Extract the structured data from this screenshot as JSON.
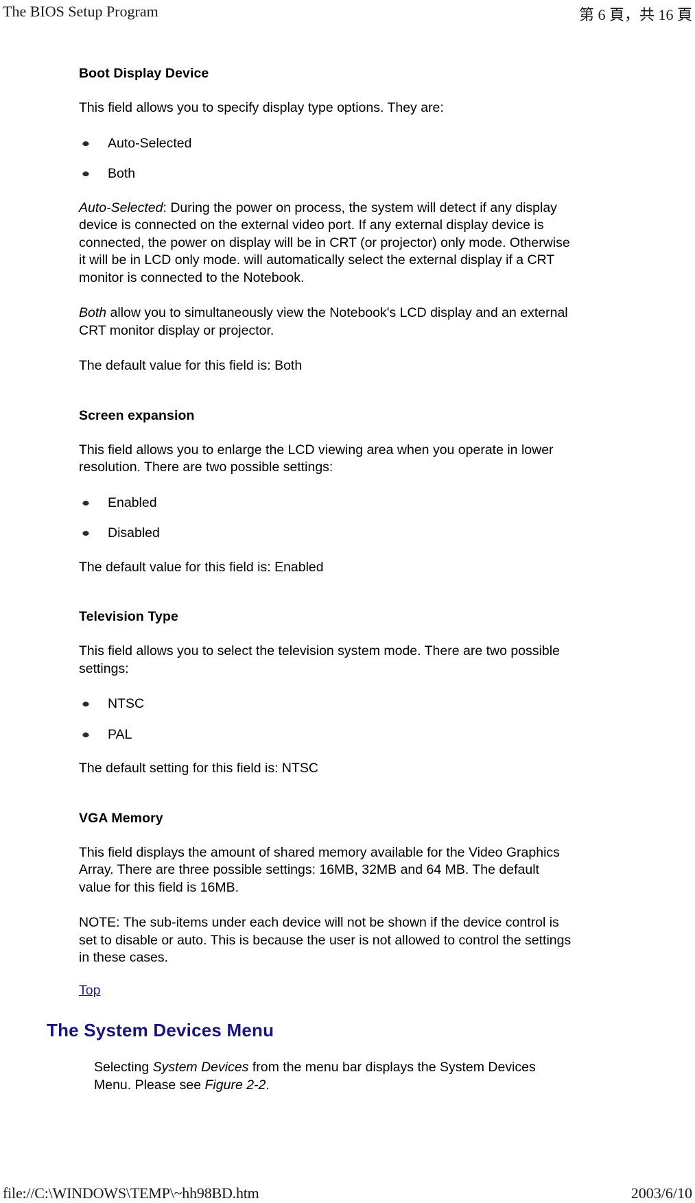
{
  "print_header": {
    "left": "The BIOS Setup Program",
    "right": "第 6 頁，共 16 頁"
  },
  "print_footer": {
    "left": "file://C:\\WINDOWS\\TEMP\\~hh98BD.htm",
    "right": "2003/6/10"
  },
  "colors": {
    "link": "#1d18a8",
    "menu_heading": "#191481",
    "text": "#000000",
    "background": "#ffffff"
  },
  "content": {
    "boot_display_device": {
      "heading": "Boot Display Device",
      "intro": "This field allows you to specify display type options. They are:",
      "options": [
        "Auto-Selected",
        "Both"
      ],
      "auto_selected_term": "Auto-Selected",
      "auto_selected_desc": ": During the power on process, the system will detect if any display device is connected on the external video port. If any external display device is connected, the power on display will be in CRT (or projector) only mode. Otherwise it will be in LCD only mode. will automatically select the external display if a CRT monitor is connected to the Notebook.",
      "both_term": "Both",
      "both_desc": " allow you to simultaneously view the Notebook's LCD display and an external CRT monitor display or projector.",
      "default_text": "The default value for this field is: Both"
    },
    "screen_expansion": {
      "heading": "Screen expansion",
      "intro": "This field allows you to enlarge the LCD viewing area when you operate in lower resolution. There are two possible settings:",
      "options": [
        "Enabled",
        "Disabled"
      ],
      "default_text": "The default value for this field is: Enabled"
    },
    "television_type": {
      "heading": "Television Type",
      "intro": "This field allows you to select the television system mode. There are two possible settings:",
      "options": [
        "NTSC",
        "PAL"
      ],
      "default_text": "The default setting for this field is: NTSC"
    },
    "vga_memory": {
      "heading": "VGA Memory",
      "body": "This field displays the amount of shared memory available for the Video Graphics Array. There are three possible settings: 16MB, 32MB and 64 MB. The default value for this field is 16MB.",
      "note": "NOTE: The sub-items under each device will not be shown if the device control is set to disable or auto. This is because the user is not allowed to control the settings in these cases."
    },
    "top_link": "Top",
    "system_devices": {
      "heading": "The System Devices Menu",
      "para_prefix": "Selecting ",
      "para_italic_1": "System Devices",
      "para_middle": " from the menu bar displays the System Devices Menu. Please see ",
      "para_italic_2": "Figure 2-2",
      "para_suffix": "."
    }
  }
}
